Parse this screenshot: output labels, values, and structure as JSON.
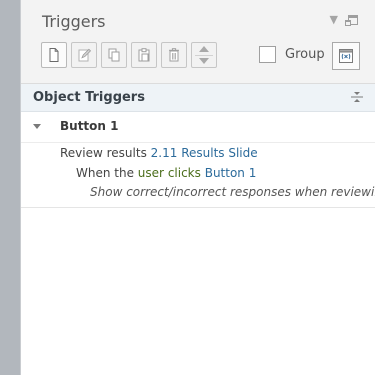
{
  "panel": {
    "title": "Triggers",
    "group_label": "Group"
  },
  "section": {
    "title": "Object Triggers"
  },
  "object": {
    "name": "Button 1"
  },
  "trigger": {
    "action_prefix": "Review results",
    "action_target": "2.11 Results Slide",
    "when_prefix": "When the",
    "when_user": "user",
    "when_verb": "clicks",
    "when_target": "Button 1",
    "option_text": "Show correct/incorrect responses when reviewing"
  },
  "colors": {
    "link": "#2c6b9b",
    "accent": "#4b6e1b",
    "left_strip": "#b2b7bd",
    "section_bg": "#eef3f7"
  },
  "icons": {
    "toolbar": [
      "new-trigger-icon",
      "edit-trigger-icon",
      "copy-icon",
      "paste-icon",
      "delete-icon",
      "move-up-down-icon"
    ],
    "right": [
      "chevron-down-icon",
      "restore-window-icon",
      "variables-icon",
      "collapse-all-icon"
    ]
  }
}
